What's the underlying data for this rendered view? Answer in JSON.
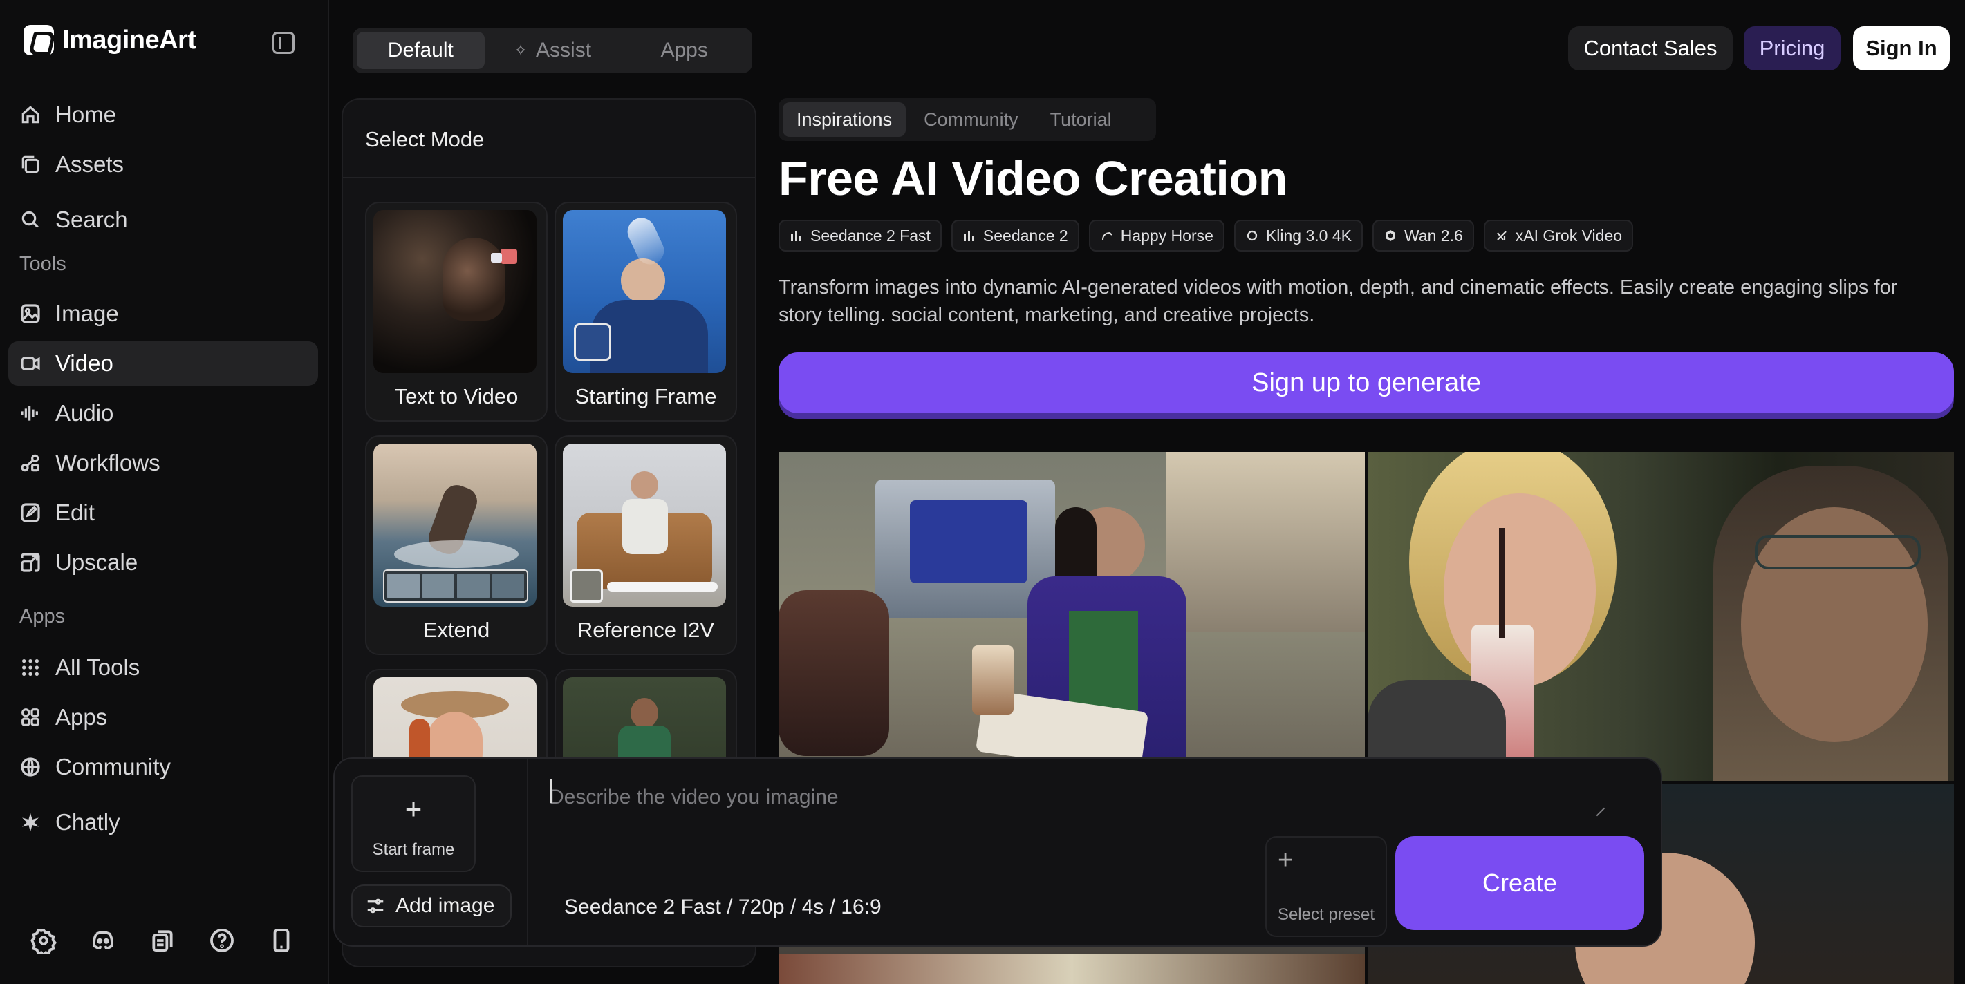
{
  "brand": {
    "name": "ImagineArt"
  },
  "sidebar": {
    "primary": [
      {
        "label": "Home",
        "icon": "home-icon"
      },
      {
        "label": "Assets",
        "icon": "assets-icon"
      },
      {
        "label": "Search",
        "icon": "search-icon"
      }
    ],
    "tools_label": "Tools",
    "tools": [
      {
        "label": "Image",
        "icon": "image-icon"
      },
      {
        "label": "Video",
        "icon": "video-icon",
        "active": true
      },
      {
        "label": "Audio",
        "icon": "audio-icon"
      },
      {
        "label": "Workflows",
        "icon": "workflows-icon"
      },
      {
        "label": "Edit",
        "icon": "edit-icon"
      },
      {
        "label": "Upscale",
        "icon": "upscale-icon"
      }
    ],
    "apps_label": "Apps",
    "apps": [
      {
        "label": "All Tools",
        "icon": "grid-icon"
      },
      {
        "label": "Apps",
        "icon": "apps-icon"
      },
      {
        "label": "Community",
        "icon": "globe-icon"
      },
      {
        "label": "Chatly",
        "icon": "chatly-icon"
      }
    ],
    "bottom_icons": [
      "settings-icon",
      "discord-icon",
      "docs-icon",
      "help-icon",
      "mobile-icon"
    ]
  },
  "mode_tabs": [
    {
      "label": "Default",
      "active": true
    },
    {
      "label": "Assist",
      "icon": "sparkle-icon"
    },
    {
      "label": "Apps"
    }
  ],
  "mode_panel": {
    "title": "Select Mode",
    "modes": [
      {
        "label": "Text to Video"
      },
      {
        "label": "Starting Frame"
      },
      {
        "label": "Extend"
      },
      {
        "label": "Reference I2V"
      },
      {
        "label": ""
      },
      {
        "label": ""
      }
    ]
  },
  "header": {
    "contact_label": "Contact Sales",
    "pricing_label": "Pricing",
    "signin_label": "Sign In"
  },
  "content_tabs": [
    {
      "label": "Inspirations",
      "active": true
    },
    {
      "label": "Community"
    },
    {
      "label": "Tutorial"
    }
  ],
  "page": {
    "title": "Free AI Video Creation",
    "models": [
      {
        "label": "Seedance 2 Fast",
        "icon": "bars-icon"
      },
      {
        "label": "Seedance 2",
        "icon": "bars-icon"
      },
      {
        "label": "Happy Horse",
        "icon": "horse-icon"
      },
      {
        "label": "Kling 3.0 4K",
        "icon": "kling-icon"
      },
      {
        "label": "Wan 2.6",
        "icon": "wan-icon"
      },
      {
        "label": "xAI Grok Video",
        "icon": "xai-icon"
      }
    ],
    "description": "Transform images into dynamic AI-generated videos with motion, depth, and cinematic effects. Easily create engaging slips for story telling. social content, marketing, and creative projects.",
    "signup_label": "Sign up to generate"
  },
  "prompt": {
    "start_frame_label": "Start frame",
    "add_image_label": "Add image",
    "placeholder": "Describe the video you imagine",
    "value": "",
    "model_summary": "Seedance 2 Fast / 720p / 4s / 16:9",
    "preset_label": "Select preset",
    "create_label": "Create"
  },
  "colors": {
    "accent": "#7a4cf2",
    "background": "#0b0b0c",
    "panel": "#131315"
  }
}
